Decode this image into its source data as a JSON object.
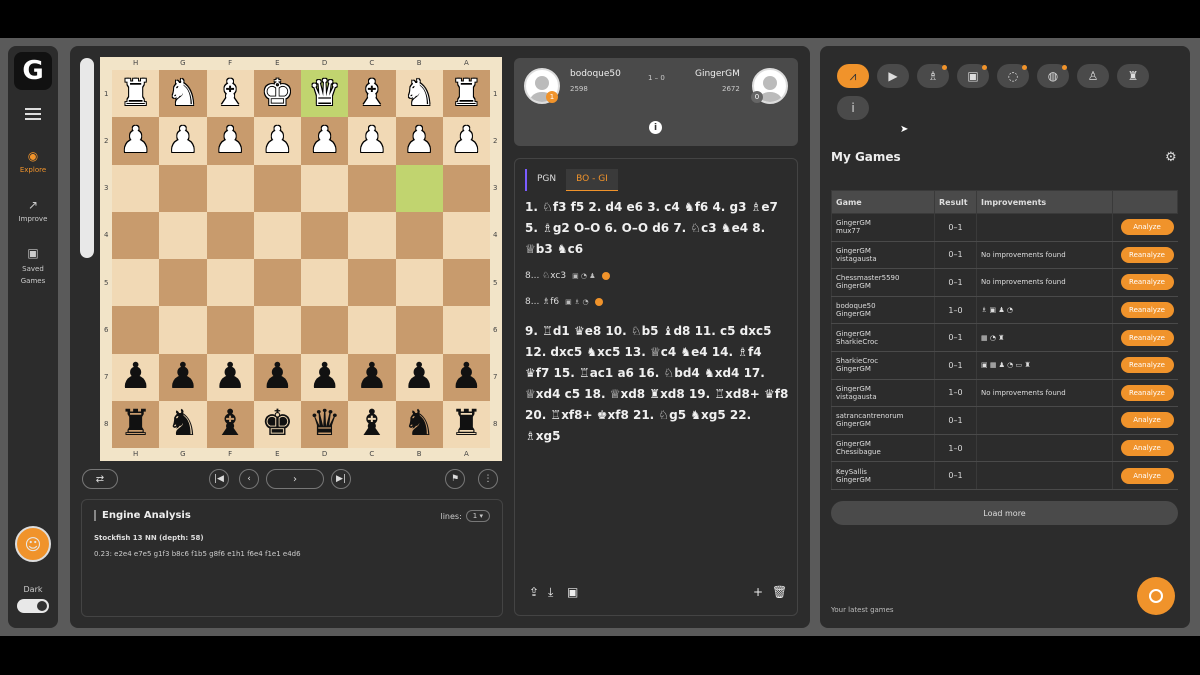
{
  "sidebar": {
    "logo": "G",
    "items": [
      {
        "label": "Explore",
        "icon": "compass-icon"
      },
      {
        "label": "Improve",
        "icon": "trend-up-icon"
      },
      {
        "label": "Saved Games",
        "icon": "save-icon"
      }
    ],
    "dark_label": "Dark"
  },
  "board": {
    "files_top": [
      "H",
      "G",
      "F",
      "E",
      "D",
      "C",
      "B",
      "A"
    ],
    "ranks": [
      "1",
      "2",
      "3",
      "4",
      "5",
      "6",
      "7",
      "8"
    ],
    "rows": [
      [
        "wR",
        "wN",
        "wB",
        "wK",
        "wQ",
        "wB",
        "wN",
        "wR"
      ],
      [
        "wP",
        "wP",
        "wP",
        "wP",
        "wP",
        "wP",
        "wP",
        "wP"
      ],
      [
        "",
        "",
        "",
        "",
        "",
        "",
        "",
        ""
      ],
      [
        "",
        "",
        "",
        "",
        "",
        "",
        "",
        ""
      ],
      [
        "",
        "",
        "",
        "",
        "",
        "",
        "",
        ""
      ],
      [
        "",
        "",
        "",
        "",
        "",
        "",
        "",
        ""
      ],
      [
        "bP",
        "bP",
        "bP",
        "bP",
        "bP",
        "bP",
        "bP",
        "bP"
      ],
      [
        "bR",
        "bN",
        "bB",
        "bK",
        "bQ",
        "bB",
        "bN",
        "bR"
      ]
    ],
    "highlights": [
      [
        0,
        4
      ],
      [
        2,
        6
      ]
    ]
  },
  "engine": {
    "title": "Engine Analysis",
    "lines_label": "lines:",
    "lines_value": "1",
    "name": "Stockfish 13 NN (depth: 58)",
    "line": "0.23: e2e4 e7e5 g1f3 b8c6 f1b5 g8f6 e1h1 f6e4 f1e1 e4d6"
  },
  "players": {
    "left": {
      "name": "bodoque50",
      "rating": "2598",
      "badge": "1"
    },
    "right": {
      "name": "GingerGM",
      "rating": "2672",
      "badge": "0"
    },
    "score": "1 – 0"
  },
  "moves_panel": {
    "tabs": [
      "PGN",
      "BO - GI"
    ],
    "moves_a": "1. ♘f3 f5 2. d4 e6 3. c4 ♞f6 4. g3 ♗e7 5. ♗g2 O–O 6. O–O d6 7. ♘c3 ♞e4 8. ♕b3 ♞c6",
    "var1": "8... ♘xc3",
    "var2": "8... ♗f6",
    "moves_b": "9. ♖d1 ♛e8 10. ♘b5 ♝d8 11. c5 dxc5 12. dxc5 ♞xc5 13. ♕c4 ♞e4 14. ♗f4 ♛f7 15. ♖ac1 a6 16. ♘bd4 ♞xd4 17. ♕xd4 c5 18. ♕xd8 ♜xd8 19. ♖xd8+ ♛f8 20. ♖xf8+ ♚xf8 21. ♘g5 ♞xg5 22. ♗xg5"
  },
  "right": {
    "title": "My Games",
    "columns": [
      "Game",
      "Result",
      "Improvements",
      ""
    ],
    "games": [
      {
        "p1": "GingerGM",
        "p2": "mux77",
        "result": "0–1",
        "improvements": "",
        "action": "Analyze"
      },
      {
        "p1": "GingerGM",
        "p2": "vistagausta",
        "result": "0–1",
        "improvements": "No improvements found",
        "action": "Reanalyze"
      },
      {
        "p1": "Chessmaster5590",
        "p2": "GingerGM",
        "result": "0–1",
        "improvements": "No improvements found",
        "action": "Reanalyze"
      },
      {
        "p1": "bodoque50",
        "p2": "GingerGM",
        "result": "1–0",
        "improvements": "♗ ▣ ♟ ◔",
        "action": "Reanalyze"
      },
      {
        "p1": "GingerGM",
        "p2": "SharkieCroc",
        "result": "0–1",
        "improvements": "▦ ◔ ♜",
        "action": "Reanalyze"
      },
      {
        "p1": "SharkieCroc",
        "p2": "GingerGM",
        "result": "0–1",
        "improvements": "▣ ▦ ♟ ◔ ▭ ♜",
        "action": "Reanalyze"
      },
      {
        "p1": "GingerGM",
        "p2": "vistagausta",
        "result": "1–0",
        "improvements": "No improvements found",
        "action": "Reanalyze"
      },
      {
        "p1": "satrancantrenorum",
        "p2": "GingerGM",
        "result": "0–1",
        "improvements": "",
        "action": "Analyze"
      },
      {
        "p1": "GingerGM",
        "p2": "Chessibague",
        "result": "1–0",
        "improvements": "",
        "action": "Analyze"
      },
      {
        "p1": "KeySallis",
        "p2": "GingerGM",
        "result": "0–1",
        "improvements": "",
        "action": "Analyze"
      }
    ],
    "load_more": "Load more",
    "latest": "Your latest games"
  },
  "colors": {
    "accent": "#f0932b",
    "panel": "#2c2c2c",
    "light_square": "#f1d9b5",
    "dark_square": "#c89b6d",
    "highlight": "#c1d46f"
  }
}
